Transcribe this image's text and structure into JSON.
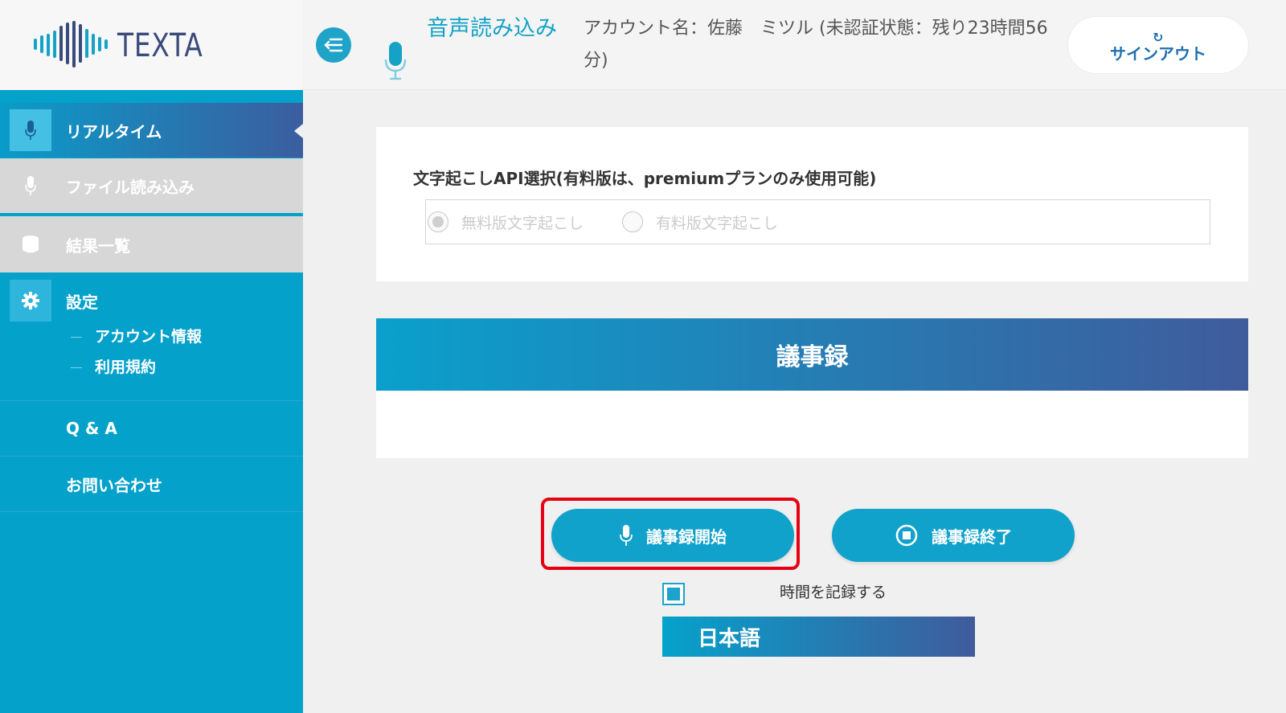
{
  "header": {
    "logo_text": "TEXTA",
    "page_title": "音声読み込み",
    "account_info": "アカウント名：佐藤　ミツル (未認証状態：残り23時間56分)",
    "signout_label": "サインアウト"
  },
  "sidebar": {
    "items": [
      {
        "label": "リアルタイム",
        "icon": "mic-icon",
        "state": "active"
      },
      {
        "label": "ファイル読み込み",
        "icon": "mic-icon",
        "state": "disabled"
      },
      {
        "label": "結果一覧",
        "icon": "database-icon",
        "state": "disabled"
      },
      {
        "label": "設定",
        "icon": "gear-icon",
        "state": "normal"
      }
    ],
    "settings_sub": [
      {
        "label": "アカウント情報"
      },
      {
        "label": "利用規約"
      }
    ],
    "qa_label": "Q & A",
    "contact_label": "お問い合わせ"
  },
  "api_select": {
    "title": "文字起こしAPI選択(有料版は、premiumプランのみ使用可能)",
    "options": [
      {
        "label": "無料版文字起こし",
        "selected": true
      },
      {
        "label": "有料版文字起こし",
        "selected": false
      }
    ]
  },
  "minutes": {
    "header": "議事録"
  },
  "controls": {
    "start_label": "議事録開始",
    "stop_label": "議事録終了",
    "time_record_label": "時間を記録する",
    "time_record_checked": true,
    "language": "日本語"
  },
  "colors": {
    "accent": "#04a1cb",
    "gradient_end": "#405b9c",
    "highlight": "#e60012"
  }
}
